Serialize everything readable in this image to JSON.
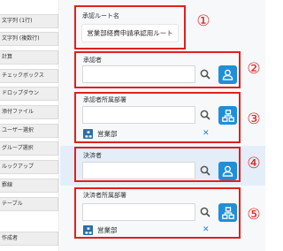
{
  "sidebar": {
    "items": [
      {
        "label": "文字列 (1行)",
        "icon": "text-field-icon"
      },
      {
        "label": "文字列 (複数行)",
        "icon": "textarea-icon"
      },
      {
        "label": "計算",
        "icon": "calc-icon"
      },
      {
        "label": "チェックボックス",
        "icon": "checkbox-icon"
      },
      {
        "label": "ドロップダウン",
        "icon": "dropdown-icon"
      },
      {
        "label": "添付ファイル",
        "icon": "attachment-icon"
      },
      {
        "label": "ユーザー選択",
        "icon": "user-select-icon"
      },
      {
        "label": "グループ選択",
        "icon": "group-select-icon"
      },
      {
        "label": "ルックアップ",
        "icon": "lookup-icon"
      },
      {
        "label": "罫線",
        "icon": "border-icon"
      },
      {
        "label": "テーブル",
        "icon": "table-icon"
      },
      {
        "label": "作成者",
        "icon": "creator-icon"
      }
    ]
  },
  "route_name": {
    "label": "承認ルート名",
    "value": "営業部経費申請承認用ルート",
    "callout": "①"
  },
  "approver": {
    "label": "承認者",
    "value": "",
    "callout": "②"
  },
  "approver_dept": {
    "label": "承認者所属部署",
    "value": "",
    "selected": "営業部",
    "callout": "③"
  },
  "decider": {
    "label": "決済者",
    "value": "",
    "callout": "④"
  },
  "decider_dept": {
    "label": "決済者所属部署",
    "value": "",
    "selected": "営業部",
    "callout": "⑤"
  },
  "icons": {
    "search": "magnifier-icon",
    "user_picker": "user-icon",
    "org_picker": "org-chart-icon",
    "remove": "close-icon"
  },
  "colors": {
    "callout": "#e02020",
    "picker_button": "#1f8fd8",
    "highlight_row": "#e4eef9",
    "remove_x": "#2b7fd0"
  }
}
